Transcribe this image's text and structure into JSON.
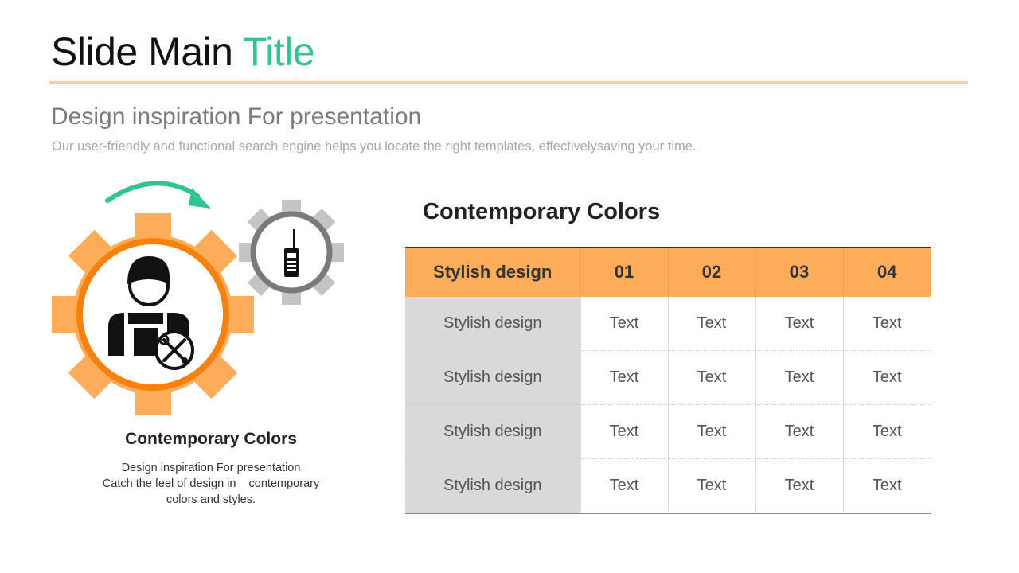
{
  "slide": {
    "title_main": "Slide Main ",
    "title_accent": "Title",
    "subtitle": "Design inspiration For presentation",
    "description": "Our user-friendly and functional search engine helps you locate the right templates, effectivelysaving your time."
  },
  "left_panel": {
    "heading": "Contemporary Colors",
    "body_lines": [
      "Design inspiration For presentation",
      "Catch the feel of design in    contemporary",
      "colors and styles."
    ],
    "icons": [
      "arrow-icon",
      "large-gear-icon",
      "worker-icon",
      "tools-icon",
      "small-gear-icon",
      "walkie-talkie-icon"
    ]
  },
  "table": {
    "heading": "Contemporary Colors",
    "header": [
      "Stylish design",
      "01",
      "02",
      "03",
      "04"
    ],
    "rows": [
      [
        "Stylish design",
        "Text",
        "Text",
        "Text",
        "Text"
      ],
      [
        "Stylish design",
        "Text",
        "Text",
        "Text",
        "Text"
      ],
      [
        "Stylish design",
        "Text",
        "Text",
        "Text",
        "Text"
      ],
      [
        "Stylish design",
        "Text",
        "Text",
        "Text",
        "Text"
      ]
    ]
  },
  "colors": {
    "accent_green": "#2ec58e",
    "rule": "#f7cf96",
    "orange_gear": "#fdac5a",
    "orange_ring": "#f5820f",
    "grey_gear": "#c4c4c4",
    "grey_ring": "#7a7a7a",
    "table_header": "#fdac5a",
    "row_label_bg": "#d9d9d9"
  }
}
